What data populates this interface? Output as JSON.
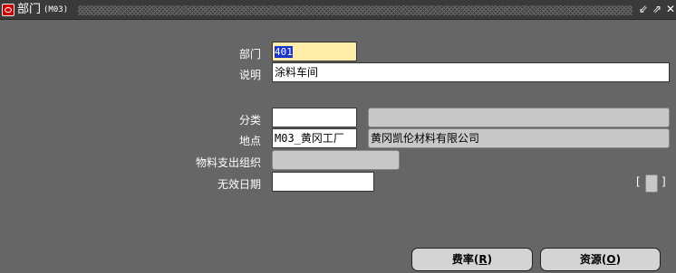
{
  "window": {
    "title": "部门",
    "code": "(M03)",
    "minimize": "⇙",
    "maximize": "⇗",
    "close": "✕"
  },
  "form": {
    "dept_label": "部门",
    "dept_value": "401",
    "desc_label": "说明",
    "desc_value": "涂料车间",
    "class_label": "分类",
    "class_value": "",
    "class_desc": "",
    "loc_label": "地点",
    "loc_value": "M03_黄冈工厂",
    "loc_desc": "黄冈凯伦材料有限公司",
    "org_label": "物料支出组织",
    "org_value": "",
    "date_label": "无效日期",
    "date_value": ""
  },
  "buttons": {
    "rates": "费率",
    "rates_key": "R",
    "resources": "资源",
    "resources_key": "O"
  },
  "colors": {
    "background": "#666666",
    "selection": "#1a33cc",
    "required": "#ffeeaa"
  }
}
